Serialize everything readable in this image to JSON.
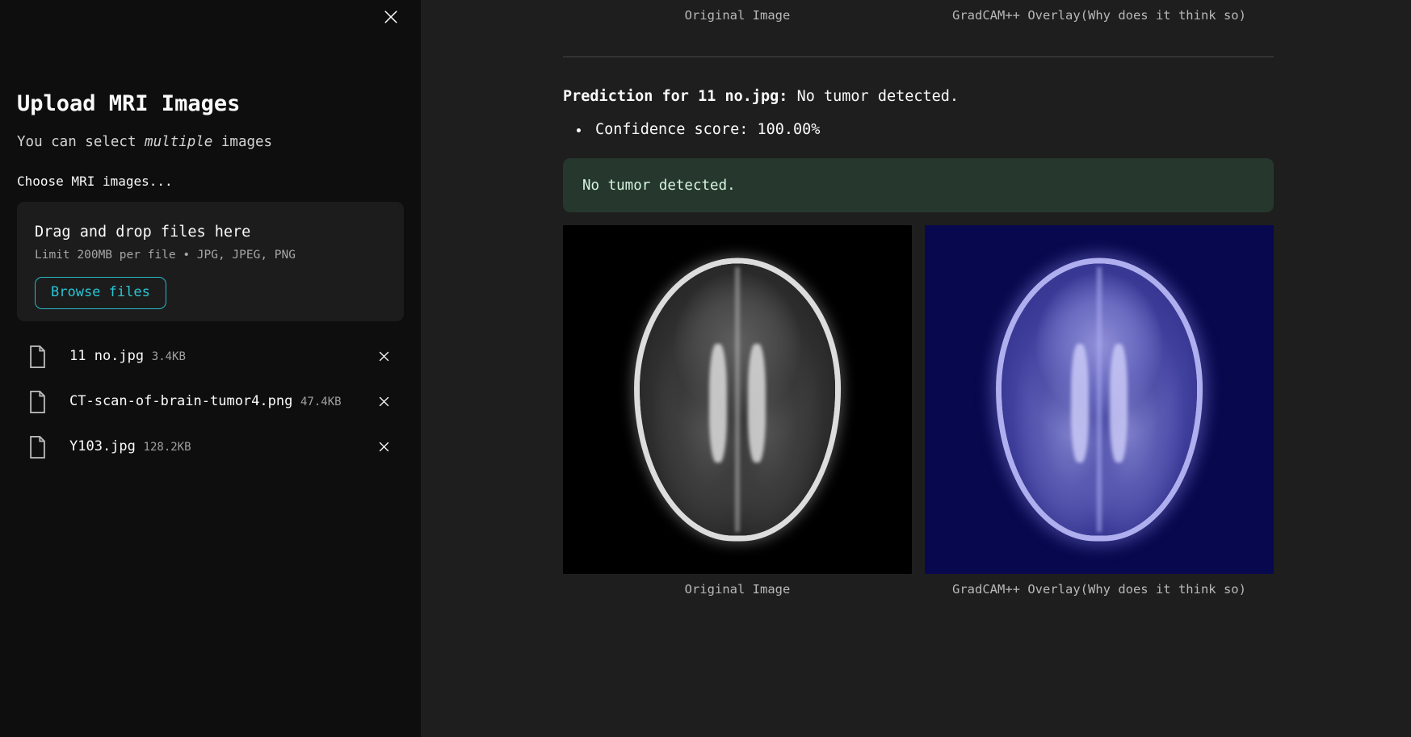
{
  "sidebar": {
    "close_icon": "close-icon",
    "title": "Upload MRI Images",
    "subtitle_prefix": "You can select ",
    "subtitle_emphasis": "multiple",
    "subtitle_suffix": " images",
    "field_label": "Choose MRI images...",
    "dropzone": {
      "title": "Drag and drop files here",
      "limit": "Limit 200MB per file • JPG, JPEG, PNG",
      "browse_label": "Browse files"
    },
    "files": [
      {
        "name": "11 no.jpg",
        "size": "3.4KB",
        "remove_icon": "close-icon"
      },
      {
        "name": "CT-scan-of-brain-tumor4.png",
        "size": "47.4KB",
        "remove_icon": "close-icon"
      },
      {
        "name": "Y103.jpg",
        "size": "128.2KB",
        "remove_icon": "close-icon"
      }
    ]
  },
  "main": {
    "previous_result": {
      "original_caption": "Original Image",
      "gradcam_caption": "GradCAM++ Overlay(Why does it think so)"
    },
    "result": {
      "prediction_label": "Prediction for 11 no.jpg:",
      "prediction_value": " No tumor detected.",
      "confidence_bullet": "Confidence score: 100.00%",
      "alert_text": "No tumor detected.",
      "original_caption": "Original Image",
      "gradcam_caption": "GradCAM++ Overlay(Why does it think so)"
    }
  },
  "colors": {
    "sidebar_bg": "#0e0e0e",
    "main_bg": "#1e1e1e",
    "accent_cyan": "#29c6d6",
    "success_bg": "#26382e",
    "success_text": "#d7f5df",
    "gradcam_bg": "#08084e"
  }
}
